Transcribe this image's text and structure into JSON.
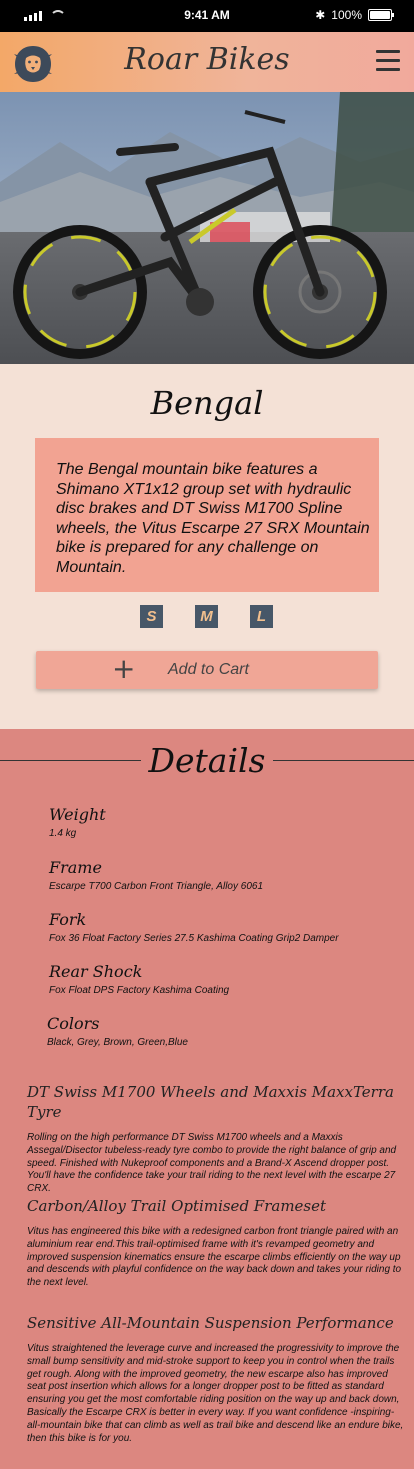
{
  "status_bar": {
    "time": "9:41 AM",
    "battery": "100%"
  },
  "header": {
    "brand": "Roar Bikes"
  },
  "product": {
    "name": "Bengal",
    "description": "The Bengal mountain bike features a Shimano XT1x12 group set with hydraulic disc brakes and DT Swiss M1700 Spline wheels, the Vitus Escarpe 27 SRX Mountain bike is prepared for any challenge on Mountain.",
    "sizes": [
      "S",
      "M",
      "L"
    ],
    "add_to_cart": "Add to Cart"
  },
  "details": {
    "title": "Details",
    "specs": [
      {
        "label": "Weight",
        "value": "1.4 kg"
      },
      {
        "label": "Frame",
        "value": "Escarpe T700 Carbon Front Triangle, Alloy 6061"
      },
      {
        "label": "Fork",
        "value": "Fox 36 Float Factory Series 27.5 Kashima Coating Grip2 Damper"
      },
      {
        "label": "Rear Shock",
        "value": "Fox Float DPS Factory Kashima Coating"
      },
      {
        "label": "Colors",
        "value": "Black, Grey, Brown, Green,Blue"
      }
    ],
    "features": [
      {
        "heading": "DT Swiss M1700 Wheels and Maxxis MaxxTerra Tyre",
        "text": "Rolling on the high performance DT Swiss M1700 wheels and  a Maxxis Assegal/Disector tubeless-ready tyre combo to provide the right balance of grip and speed. Finished with Nukeproof components and a Brand-X Ascend dropper post. You'll have the confidence take your trail riding to the next level with the escarpe 27 CRX."
      },
      {
        "heading": "Carbon/Alloy Trail Optimised Frameset",
        "text": "Vitus has engineered this bike with a redesigned carbon front triangle paired with an aluminium rear end.This trail-optimised frame with it's revamped geometry and improved suspension kinematics ensure the escarpe climbs efficiently on the way up and descends with playful confidence on the way back down and takes your riding to the next level."
      },
      {
        "heading": "Sensitive All-Mountain Suspension Performance",
        "text": "Vitus straightened the leverage curve and increased the progressivity to improve the small bump  sensitivity and mid-stroke support to keep you in control when the trails get rough. Along with the improved geometry, the new escarpe also has improved seat post insertion which allows for a longer dropper post to be fitted as standard ensuring you get the most comfortable riding position on the way up and back down, Basically the Escarpe CRX is better in every way. If you want confidence -inspiring-all-mountain bike that can climb as well as trail bike and descend like an endure bike, then this bike is for you."
      }
    ]
  },
  "colors": {
    "header": "#f3a868",
    "product_bg": "#f4e1d6",
    "desc_bg": "#f2a392",
    "details_bg": "#dc8780",
    "size_btn": "#475768"
  }
}
